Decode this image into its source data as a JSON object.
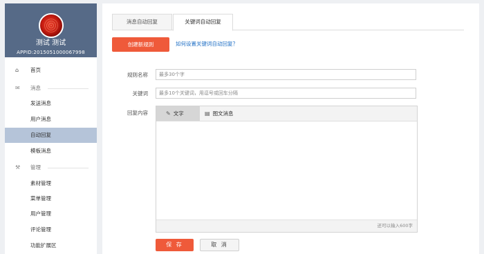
{
  "profile": {
    "name": "测试 测试",
    "appid": "APPID:2015051000067998"
  },
  "sidebar": {
    "home": {
      "label": "首页",
      "icon": "home-icon"
    },
    "sections": [
      {
        "title": "消息",
        "icon": "envelope-icon",
        "items": [
          "发送消息",
          "用户消息",
          "自动回复",
          "模板消息"
        ]
      },
      {
        "title": "管理",
        "icon": "wrench-icon",
        "items": [
          "素材管理",
          "菜单管理",
          "用户管理",
          "评论管理",
          "功能扩展区"
        ]
      }
    ],
    "active_item": "自动回复"
  },
  "tabs": {
    "auto_reply": "消息自动回复",
    "keyword_reply": "关键词自动回复",
    "active": "关键词自动回复"
  },
  "toolbar": {
    "create_label": "创建新规则",
    "help_link": "如何设置关键词自动回复？"
  },
  "form": {
    "rule_name_label": "规则名称",
    "rule_name_placeholder": "最多30个字",
    "keyword_label": "关键词",
    "keyword_placeholder": "最多10个关键词，用逗号或回车分隔",
    "reply_label": "回复内容",
    "editor_tabs": {
      "text": "文字",
      "news": "图文消息"
    },
    "char_counter": "还可以输入600字",
    "save_label": "保 存",
    "cancel_label": "取 消"
  },
  "colors": {
    "accent": "#ef5a3a",
    "sidebar_header": "#566a87",
    "active_nav": "#b5c4d9",
    "link": "#1f6fc5"
  }
}
